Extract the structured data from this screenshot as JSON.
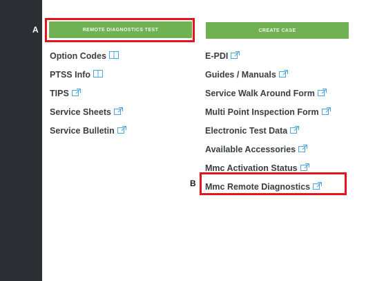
{
  "annotations": {
    "a": "A",
    "b": "B"
  },
  "buttons": {
    "remote_diagnostics_test": "REMOTE DIAGNOSTICS TEST",
    "create_case": "CREATE CASE"
  },
  "left_links": [
    {
      "label": "Option Codes",
      "icon": "book-icon"
    },
    {
      "label": "PTSS Info",
      "icon": "book-icon"
    },
    {
      "label": "TIPS",
      "icon": "external-link-icon"
    },
    {
      "label": "Service Sheets",
      "icon": "external-link-icon"
    },
    {
      "label": "Service Bulletin",
      "icon": "external-link-icon"
    }
  ],
  "right_links": [
    {
      "label": "E-PDI",
      "icon": "external-link-icon"
    },
    {
      "label": "Guides / Manuals",
      "icon": "external-link-icon"
    },
    {
      "label": "Service Walk Around Form",
      "icon": "external-link-icon"
    },
    {
      "label": "Multi Point Inspection Form",
      "icon": "external-link-icon"
    },
    {
      "label": "Electronic Test Data",
      "icon": "external-link-icon"
    },
    {
      "label": "Available Accessories",
      "icon": "external-link-icon"
    },
    {
      "label": "Mmc Activation Status",
      "icon": "external-link-icon"
    },
    {
      "label": "Mmc Remote Diagnostics",
      "icon": "external-link-icon"
    }
  ],
  "colors": {
    "sidebar": "#2b2e33",
    "button_green": "#6fb153",
    "highlight_red": "#e3141c",
    "link_text": "#3a3d42",
    "icon_blue": "#4aa3df"
  }
}
